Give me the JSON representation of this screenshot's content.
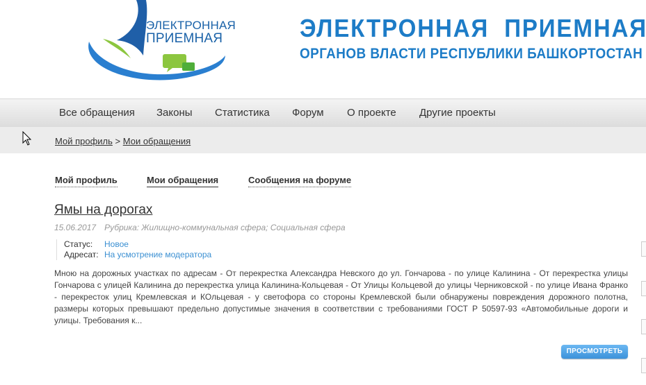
{
  "header": {
    "logo_line1": "ЭЛЕКТРОННАЯ",
    "logo_line2": "ПРИЕМНАЯ",
    "title_line1": "ЭЛЕКТРОННАЯ  ПРИЕМНАЯ",
    "title_line2": "ОРГАНОВ ВЛАСТИ РЕСПУБЛИКИ БАШКОРТОСТАН"
  },
  "nav": {
    "items": [
      {
        "label": "Все обращения"
      },
      {
        "label": "Законы"
      },
      {
        "label": "Статистика"
      },
      {
        "label": "Форум"
      },
      {
        "label": "О проекте"
      },
      {
        "label": "Другие проекты"
      }
    ]
  },
  "breadcrumb": {
    "item1": "Мой профиль",
    "separator": ">",
    "item2": "Мои обращения"
  },
  "tabs": [
    {
      "label": "Мой профиль"
    },
    {
      "label": "Мои обращения"
    },
    {
      "label": "Сообщения на форуме"
    }
  ],
  "appeal": {
    "title": "Ямы на дорогах",
    "date": "15.06.2017",
    "rubric": "Рубрика: Жилищно-коммунальная сфера; Социальная сфера",
    "status_label": "Статус:",
    "status_value": "Новое",
    "addressee_label": "Адресат:",
    "addressee_value": "На усмотрение модератора",
    "body": "Мною на дорожных участках по адресам - От перекрестка Александра Невского до ул. Гончарова - по улице Калинина - От перекрестка улицы Гончарова с улицей Калинина до перекрестка улица Калинина-Кольцевая - От Улицы Кольцевой до улицы Черниковской - по улице Ивана Франко - перекресток улиц Кремлевская и КОльцевая - у светофора со стороны Кремлевской были обнаружены повреждения дорожного полотна, размеры которых превышают предельно допустимые значения в соответствии с требованиями ГОСТ Р 50597-93 «Автомобильные дороги и улицы. Требования к...",
    "view_button": "ПРОСМОТРЕТЬ"
  },
  "colors": {
    "brand_blue": "#1d7cc7",
    "link_blue": "#3a8fd2"
  }
}
